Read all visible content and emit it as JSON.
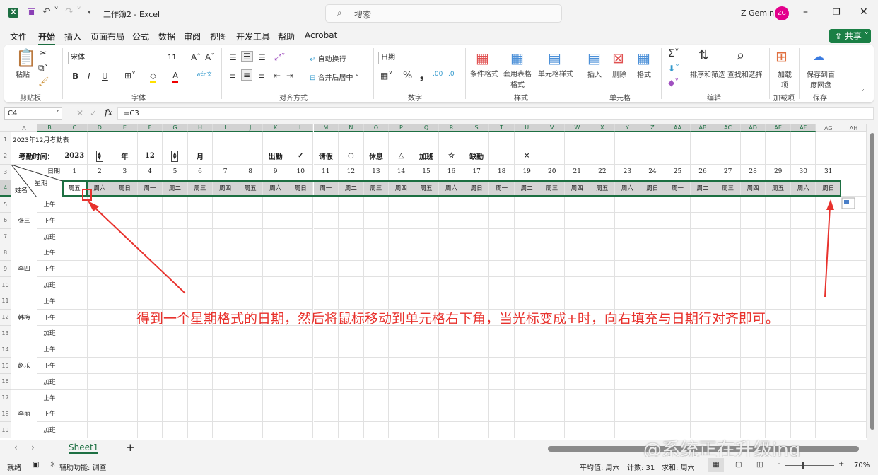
{
  "window": {
    "title": "工作簿2 - Excel",
    "search_placeholder": "搜索",
    "user": "Z Gemini",
    "avatar": "ZG",
    "share": "共享"
  },
  "menu_tabs": [
    "文件",
    "开始",
    "插入",
    "页面布局",
    "公式",
    "数据",
    "审阅",
    "视图",
    "开发工具",
    "帮助",
    "Acrobat"
  ],
  "ribbon": {
    "paste": "粘贴",
    "clipboard": "剪贴板",
    "font_name": "宋体",
    "font_size": "11",
    "font_group": "字体",
    "bold": "B",
    "italic": "I",
    "underline": "U",
    "phonetic": "wén文",
    "wrap": "自动换行",
    "merge": "合并后居中",
    "align_group": "对齐方式",
    "number_format": "日期",
    "number_group": "数字",
    "cond_format": "条件格式",
    "table_format": "套用表格格式",
    "cell_style": "单元格样式",
    "style_group": "样式",
    "insert": "插入",
    "delete": "删除",
    "format": "格式",
    "cells_group": "单元格",
    "sort_filter": "排序和筛选",
    "find_select": "查找和选择",
    "edit_group": "编辑",
    "addins": "加载项",
    "addins_btn": "加载项",
    "save_baidu": "保存到百度网盘",
    "save_group": "保存"
  },
  "formula_bar": {
    "name_box": "C4",
    "fx": "fx",
    "formula": "=C3"
  },
  "columns": [
    "A",
    "B",
    "C",
    "D",
    "E",
    "F",
    "G",
    "H",
    "I",
    "J",
    "K",
    "L",
    "M",
    "N",
    "O",
    "P",
    "Q",
    "R",
    "S",
    "T",
    "U",
    "V",
    "W",
    "X",
    "Y",
    "Z",
    "AA",
    "AB",
    "AC",
    "AD",
    "AE",
    "AF",
    "AG",
    "AH"
  ],
  "rows": [
    "1",
    "2",
    "3",
    "4",
    "5",
    "6",
    "7",
    "8",
    "9",
    "10",
    "11",
    "12",
    "13",
    "14",
    "15",
    "16",
    "17",
    "18",
    "19"
  ],
  "sheet": {
    "title": "2023年12月考勤表",
    "time_label": "考勤时间：",
    "year": "2023",
    "year_unit": "年",
    "month": "12",
    "month_unit": "月",
    "legend": [
      {
        "col": "K",
        "text": "出勤"
      },
      {
        "col": "L",
        "text": "✓"
      },
      {
        "col": "M",
        "text": "请假"
      },
      {
        "col": "N",
        "text": "○"
      },
      {
        "col": "O",
        "text": "休息"
      },
      {
        "col": "P",
        "text": "△"
      },
      {
        "col": "Q",
        "text": "加班"
      },
      {
        "col": "R",
        "text": "☆"
      },
      {
        "col": "S",
        "text": "缺勤"
      },
      {
        "col": "U",
        "text": "×"
      }
    ],
    "date_label": "日期",
    "weekday_label": "星期",
    "name_label": "姓名",
    "days": [
      "1",
      "2",
      "3",
      "4",
      "5",
      "6",
      "7",
      "8",
      "9",
      "10",
      "11",
      "12",
      "13",
      "14",
      "15",
      "16",
      "17",
      "18",
      "19",
      "20",
      "21",
      "22",
      "23",
      "24",
      "25",
      "26",
      "27",
      "28",
      "29",
      "30",
      "31"
    ],
    "weekdays": [
      "周五",
      "周六",
      "周日",
      "周一",
      "周二",
      "周三",
      "周四",
      "周五",
      "周六",
      "周日",
      "周一",
      "周二",
      "周三",
      "周四",
      "周五",
      "周六",
      "周日",
      "周一",
      "周二",
      "周三",
      "周四",
      "周五",
      "周六",
      "周日",
      "周一",
      "周二",
      "周三",
      "周四",
      "周五",
      "周六",
      "周日"
    ],
    "employees": [
      "张三",
      "李四",
      "韩梅",
      "赵乐",
      "李丽"
    ],
    "periods": [
      "上午",
      "下午",
      "加班"
    ]
  },
  "annotation": "得到一个星期格式的日期，然后将鼠标移动到单元格右下角，当光标变成+时，向右填充与日期行对齐即可。",
  "sheet_tabs": {
    "active": "Sheet1",
    "add": "+"
  },
  "status": {
    "ready": "就绪",
    "accessibility": "辅助功能: 调查",
    "average": "平均值: 周六",
    "count": "计数: 31",
    "sum": "求和: 周六",
    "zoom": "70%"
  },
  "watermark": "@系统正在升级ing",
  "colors": {
    "accent": "#1d6f42",
    "annotation": "#e8322d",
    "avatar": "#e3008c"
  }
}
